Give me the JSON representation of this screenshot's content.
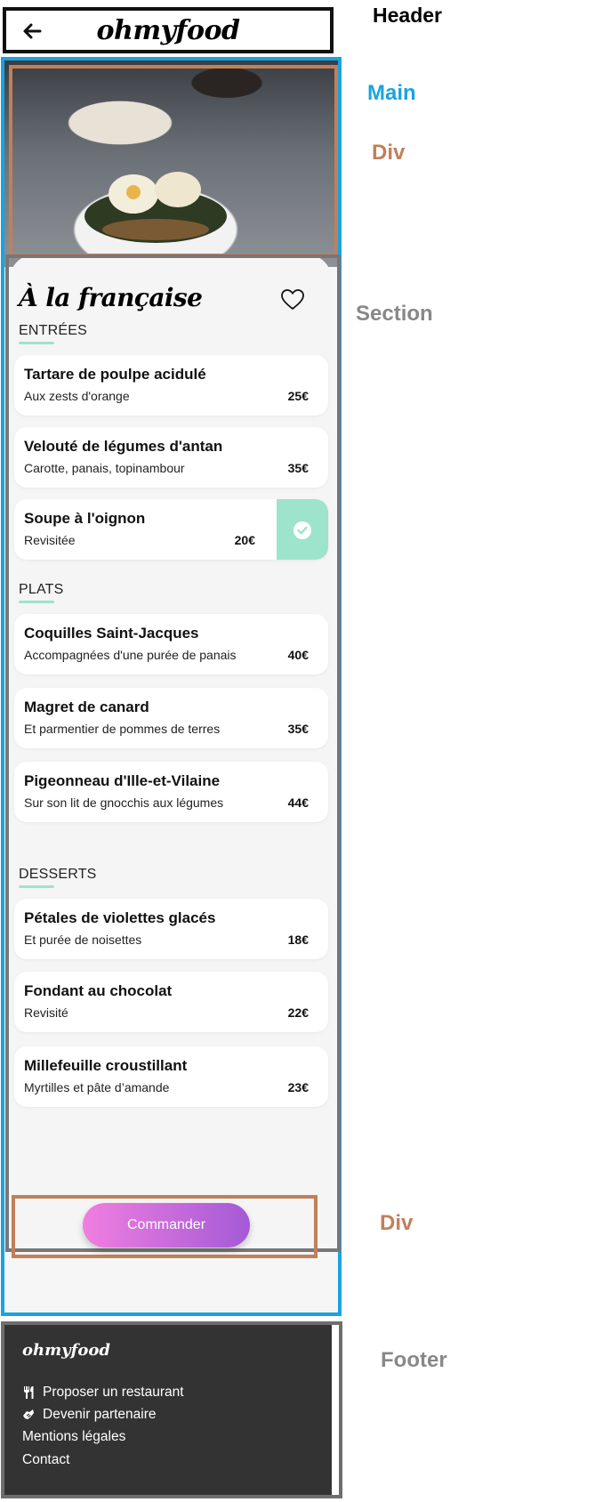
{
  "annotations": {
    "header": "Header",
    "main": "Main",
    "div_top": "Div",
    "section": "Section",
    "div_bottom": "Div",
    "footer": "Footer"
  },
  "colors": {
    "header_border": "#111111",
    "main_border": "#1aa3e0",
    "div_border": "#c0805a",
    "section_border": "#777777",
    "accent_mint": "#9ee3cc",
    "button_gradient_start": "#f07ee0",
    "button_gradient_end": "#a45ad6",
    "footer_bg": "#333333"
  },
  "header": {
    "logo": "ohmyfood",
    "back_icon": "arrow-left-icon"
  },
  "menu": {
    "title": "À la française",
    "heart_icon": "heart-icon",
    "categories": [
      {
        "label": "ENTRÉES",
        "dishes": [
          {
            "name": "Tartare de poulpe acidulé",
            "desc": "Aux zests d'orange",
            "price": "25€"
          },
          {
            "name": "Velouté de légumes d'antan",
            "desc": "Carotte, panais, topinambour",
            "price": "35€"
          },
          {
            "name": "Soupe à l'oignon",
            "desc": "Revisitée",
            "price": "20€",
            "selected": true
          }
        ]
      },
      {
        "label": "PLATS",
        "dishes": [
          {
            "name": "Coquilles Saint-Jacques",
            "desc": "Accompagnées d'une purée de panais",
            "price": "40€"
          },
          {
            "name": "Magret de canard",
            "desc": "Et parmentier de pommes de terres",
            "price": "35€"
          },
          {
            "name": "Pigeonneau d'Ille-et-Vilaine",
            "desc": "Sur son lit de gnocchis aux légumes",
            "price": "44€"
          }
        ]
      },
      {
        "label": "DESSERTS",
        "dishes": [
          {
            "name": "Pétales de violettes glacés",
            "desc": "Et purée de noisettes",
            "price": "18€"
          },
          {
            "name": "Fondant au chocolat",
            "desc": "Revisité",
            "price": "22€"
          },
          {
            "name": "Millefeuille croustillant",
            "desc": "Myrtilles et pâte d’amande",
            "price": "23€"
          }
        ]
      }
    ],
    "order_button": "Commander"
  },
  "footer": {
    "logo": "ohmyfood",
    "links": [
      {
        "label": "Proposer un restaurant",
        "icon": "utensils-icon"
      },
      {
        "label": "Devenir partenaire",
        "icon": "handshake-icon"
      },
      {
        "label": "Mentions légales"
      },
      {
        "label": "Contact"
      }
    ]
  }
}
